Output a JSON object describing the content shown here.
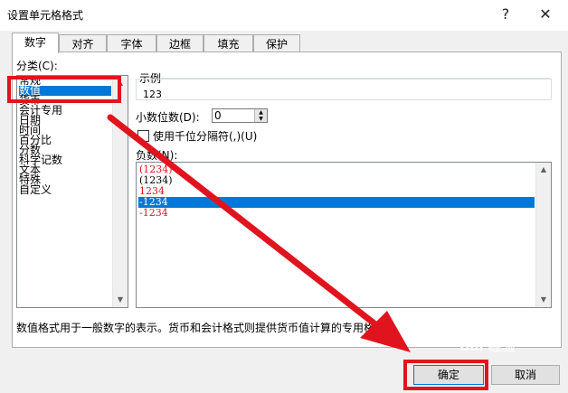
{
  "window": {
    "title": "设置单元格格式",
    "help_label": "?",
    "close_label": "✕"
  },
  "tabs": [
    {
      "label": "数字",
      "active": true
    },
    {
      "label": "对齐",
      "active": false
    },
    {
      "label": "字体",
      "active": false
    },
    {
      "label": "边框",
      "active": false
    },
    {
      "label": "填充",
      "active": false
    },
    {
      "label": "保护",
      "active": false
    }
  ],
  "category": {
    "label": "分类(C):",
    "items": [
      "常规",
      "数值",
      "货币",
      "会计专用",
      "日期",
      "时间",
      "百分比",
      "分数",
      "科学记数",
      "文本",
      "特殊",
      "自定义"
    ],
    "selected": "数值"
  },
  "sample": {
    "label": "示例",
    "value": "123"
  },
  "decimals": {
    "label": "小数位数(D):",
    "value": "0"
  },
  "thousands": {
    "label": "使用千位分隔符(,)(U)",
    "checked": false
  },
  "negative": {
    "label": "负数(N):",
    "items": [
      {
        "text": "(1234)",
        "color": "#e0141e"
      },
      {
        "text": "(1234)",
        "color": "#000000"
      },
      {
        "text": "1234",
        "color": "#e0141e"
      },
      {
        "text": "-1234",
        "color": "#ffffff"
      },
      {
        "text": "-1234",
        "color": "#e0141e"
      }
    ],
    "selected_index": 3
  },
  "description": "数值格式用于一般数字的表示。货币和会计格式则提供货币值计算的专用格式。",
  "buttons": {
    "ok": "确定",
    "cancel": "取消"
  },
  "colors": {
    "selection": "#0078d7",
    "annotation": "#e0141e"
  }
}
